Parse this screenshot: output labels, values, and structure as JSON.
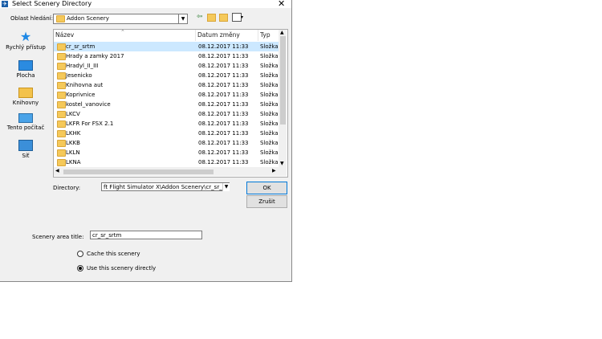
{
  "window": {
    "title": "Select Scenery Directory"
  },
  "look_in": {
    "label": "Oblast hledání:",
    "value": "Addon Scenery"
  },
  "places": [
    {
      "label": "Rychlý přístup",
      "icon": "star-icon"
    },
    {
      "label": "Plocha",
      "icon": "desktop-icon"
    },
    {
      "label": "Knihovny",
      "icon": "libraries-icon"
    },
    {
      "label": "Tento počítač",
      "icon": "computer-icon"
    },
    {
      "label": "Síť",
      "icon": "network-icon"
    }
  ],
  "columns": {
    "name": "Název",
    "date": "Datum změny",
    "type": "Typ"
  },
  "files": [
    {
      "name": "cr_sr_srtm",
      "date": "08.12.2017 11:33",
      "type": "Složka",
      "selected": true
    },
    {
      "name": "Hrady a zamky 2017",
      "date": "08.12.2017 11:33",
      "type": "Složka"
    },
    {
      "name": "Hradyl_II_III",
      "date": "08.12.2017 11:33",
      "type": "Složka"
    },
    {
      "name": "Jesenicko",
      "date": "08.12.2017 11:33",
      "type": "Složka"
    },
    {
      "name": "Knihovna aut",
      "date": "08.12.2017 11:33",
      "type": "Složka"
    },
    {
      "name": "Koprivnice",
      "date": "08.12.2017 11:33",
      "type": "Složka"
    },
    {
      "name": "kostel_vanovice",
      "date": "08.12.2017 11:33",
      "type": "Složka"
    },
    {
      "name": "LKCV",
      "date": "08.12.2017 11:33",
      "type": "Složka"
    },
    {
      "name": "LKFR For FSX 2.1",
      "date": "08.12.2017 11:33",
      "type": "Složka"
    },
    {
      "name": "LKHK",
      "date": "08.12.2017 11:33",
      "type": "Složka"
    },
    {
      "name": "LKKB",
      "date": "08.12.2017 11:33",
      "type": "Složka"
    },
    {
      "name": "LKLN",
      "date": "08.12.2017 11:33",
      "type": "Složka"
    },
    {
      "name": "LKNA",
      "date": "08.12.2017 11:33",
      "type": "Složka"
    }
  ],
  "directory": {
    "label": "Directory:",
    "value": "ft Flight Simulator X\\Addon Scenery\\cr_sr_srtm"
  },
  "buttons": {
    "ok": "OK",
    "cancel": "Zrušit"
  },
  "scenery_title": {
    "label": "Scenery area title:",
    "value": "cr_sr_srtm"
  },
  "options": [
    {
      "label": "Cache this scenery",
      "checked": false
    },
    {
      "label": "Use this scenery directly",
      "checked": true
    }
  ]
}
